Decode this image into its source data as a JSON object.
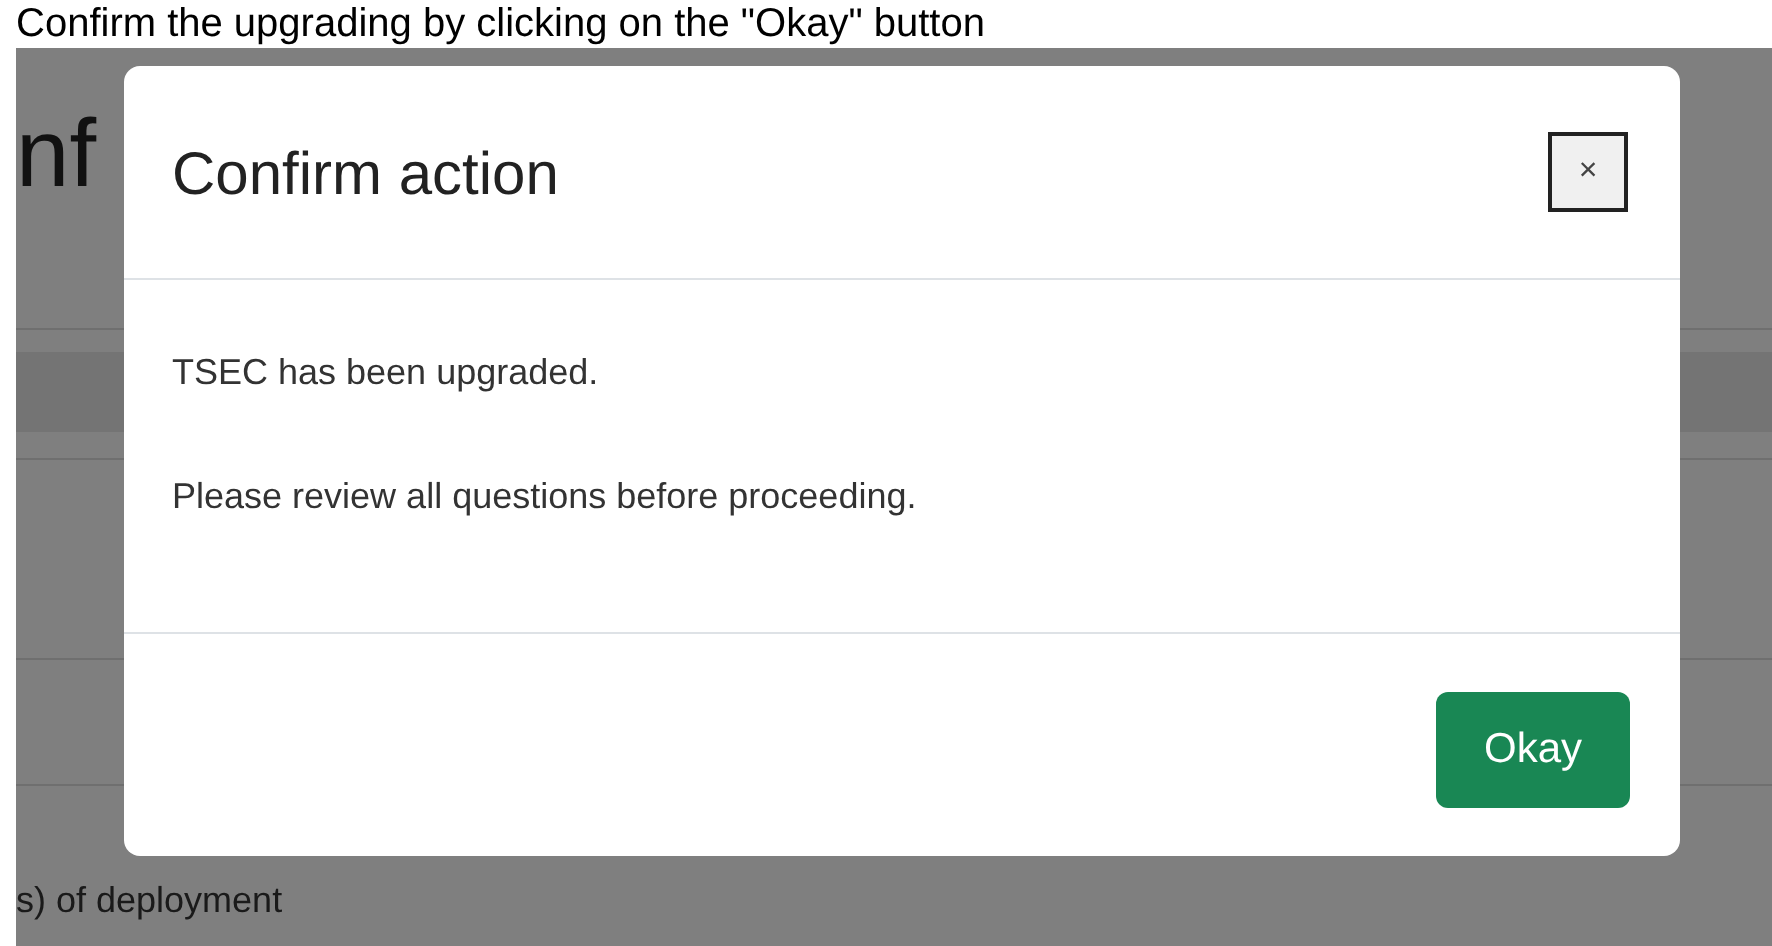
{
  "caption": "Confirm the upgrading by clicking on the \"Okay\" button",
  "background_page": {
    "heading": "nf",
    "field_label": "s) of deployment"
  },
  "modal": {
    "title": "Confirm action",
    "close": "×",
    "messages": [
      "TSEC has been upgraded.",
      "Please review all questions before proceeding."
    ],
    "buttons": [
      {
        "label": "Okay",
        "kind": "primary"
      }
    ]
  }
}
